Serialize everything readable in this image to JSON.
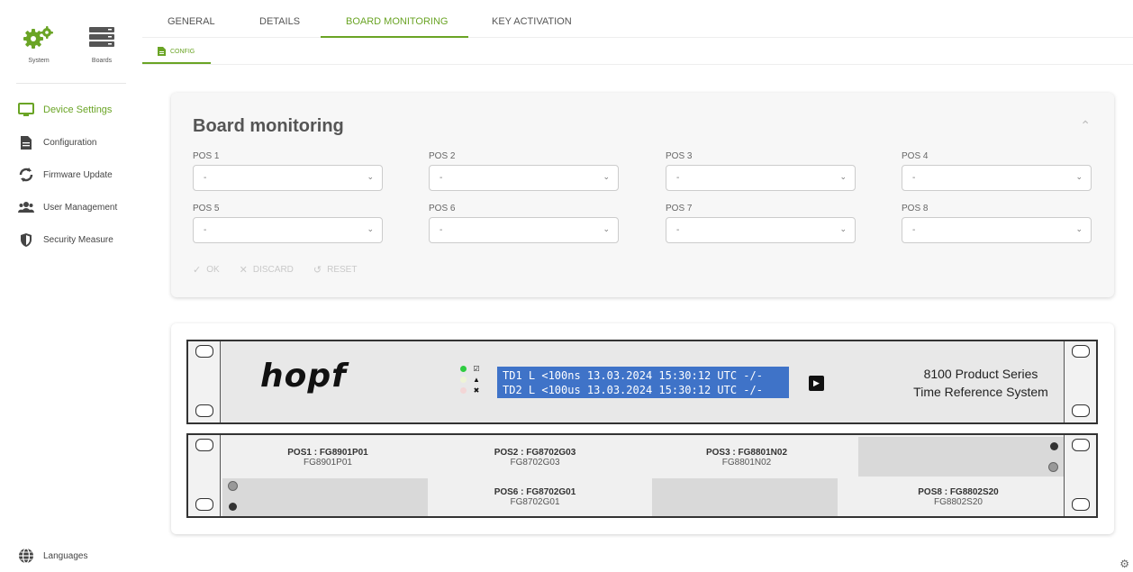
{
  "sidebar": {
    "top": [
      {
        "label": "System",
        "icon": "gears-icon"
      },
      {
        "label": "Boards",
        "icon": "server-icon"
      }
    ],
    "items": [
      {
        "label": "Device Settings",
        "icon": "monitor-icon",
        "active": true
      },
      {
        "label": "Configuration",
        "icon": "document-icon"
      },
      {
        "label": "Firmware Update",
        "icon": "refresh-icon"
      },
      {
        "label": "User Management",
        "icon": "users-icon"
      },
      {
        "label": "Security Measure",
        "icon": "shield-icon"
      }
    ],
    "languages": "Languages"
  },
  "tabs": [
    "GENERAL",
    "DETAILS",
    "BOARD MONITORING",
    "KEY ACTIVATION"
  ],
  "active_tab": "BOARD MONITORING",
  "subtab": "CONFIG",
  "card": {
    "title": "Board monitoring",
    "fields": [
      {
        "label": "POS 1",
        "value": "-"
      },
      {
        "label": "POS 2",
        "value": "-"
      },
      {
        "label": "POS 3",
        "value": "-"
      },
      {
        "label": "POS 4",
        "value": "-"
      },
      {
        "label": "POS 5",
        "value": "-"
      },
      {
        "label": "POS 6",
        "value": "-"
      },
      {
        "label": "POS 7",
        "value": "-"
      },
      {
        "label": "POS 8",
        "value": "-"
      }
    ],
    "actions": {
      "ok": "OK",
      "discard": "DISCARD",
      "reset": "RESET"
    }
  },
  "device": {
    "logo": "hopf",
    "display_line1": "TD1 L <100ns 13.03.2024 15:30:12 UTC -/-",
    "display_line2": "TD2 L <100us 13.03.2024 15:30:12 UTC -/-",
    "series_line1": "8100 Product Series",
    "series_line2": "Time Reference System",
    "slots": [
      {
        "title": "POS1 : FG8901P01",
        "sub": "FG8901P01"
      },
      {
        "title": "POS2 : FG8702G03",
        "sub": "FG8702G03"
      },
      {
        "title": "POS3 : FG8801N02",
        "sub": "FG8801N02"
      },
      {
        "title": "POS6 : FG8702G01",
        "sub": "FG8702G01"
      },
      {
        "title": "POS8 : FG8802S20",
        "sub": "FG8802S20"
      }
    ]
  },
  "colors": {
    "accent": "#6aa425",
    "display": "#3f73c8"
  }
}
